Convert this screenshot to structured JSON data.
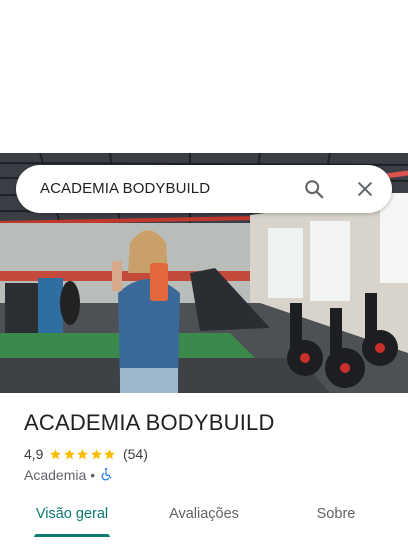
{
  "search": {
    "query": "ACADEMIA BODYBUILD",
    "search_icon": "search-icon",
    "close_icon": "close-icon"
  },
  "place": {
    "title": "ACADEMIA BODYBUILD",
    "rating": "4,9",
    "rating_stars": 5,
    "review_count": "(54)",
    "category": "Academia",
    "separator": "•",
    "accessibility_icon": "wheelchair-icon"
  },
  "tabs": [
    {
      "label": "Visão geral",
      "active": true
    },
    {
      "label": "Avaliações",
      "active": false
    },
    {
      "label": "Sobre",
      "active": false
    }
  ],
  "colors": {
    "accent": "#0b7a70",
    "star": "#fbbc04",
    "wheelchair": "#1a73e8"
  }
}
